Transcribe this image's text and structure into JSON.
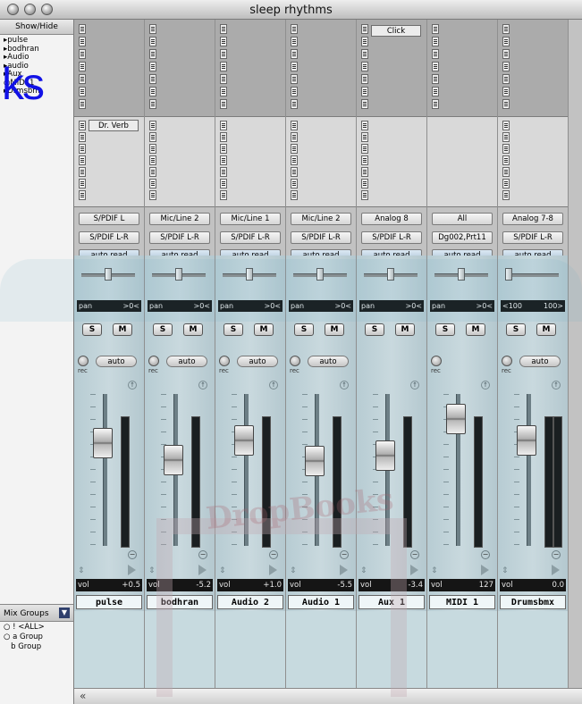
{
  "window": {
    "title": "sleep rhythms"
  },
  "left_panel": {
    "show_hide": "Show/Hide",
    "tree_items": [
      "pulse",
      "bodhran",
      "Audio",
      "audio",
      "Aux",
      "MIDI 1",
      "Drmsbm"
    ],
    "overlay_text": "ks",
    "mix_groups_label": "Mix Groups",
    "groups": [
      {
        "key": "!",
        "name": "<ALL>"
      },
      {
        "key": "a",
        "name": "Group"
      },
      {
        "key": "b",
        "name": "Group"
      }
    ]
  },
  "watermark": {
    "text": "DropBooks"
  },
  "strips": [
    {
      "name": "pulse",
      "insert_top": "",
      "insert_bottom": "Dr. Verb",
      "input": "S/PDIF L",
      "output": "S/PDIF L-R",
      "automation": "auto read",
      "pan_label": "pan",
      "pan_value": ">0<",
      "solo": "S",
      "mute": "M",
      "rec": "rec",
      "auto": "auto",
      "vol_label": "vol",
      "vol_value": "+0.5",
      "fader_level": 0.72,
      "pan_position": 0.5,
      "has_inserts": true
    },
    {
      "name": "bodhran",
      "insert_top": "",
      "insert_bottom": "",
      "input": "Mic/Line 2",
      "output": "S/PDIF L-R",
      "automation": "auto read",
      "pan_label": "pan",
      "pan_value": ">0<",
      "solo": "S",
      "mute": "M",
      "rec": "rec",
      "auto": "auto",
      "vol_label": "vol",
      "vol_value": "-5.2",
      "fader_level": 0.58,
      "pan_position": 0.5,
      "has_inserts": true
    },
    {
      "name": "Audio 2",
      "insert_top": "",
      "insert_bottom": "",
      "input": "Mic/Line 1",
      "output": "S/PDIF L-R",
      "automation": "auto read",
      "pan_label": "pan",
      "pan_value": ">0<",
      "solo": "S",
      "mute": "M",
      "rec": "rec",
      "auto": "auto",
      "vol_label": "vol",
      "vol_value": "+1.0",
      "fader_level": 0.74,
      "pan_position": 0.5,
      "has_inserts": true
    },
    {
      "name": "Audio 1",
      "insert_top": "",
      "insert_bottom": "",
      "input": "Mic/Line 2",
      "output": "S/PDIF L-R",
      "automation": "auto read",
      "pan_label": "pan",
      "pan_value": ">0<",
      "solo": "S",
      "mute": "M",
      "rec": "rec",
      "auto": "auto",
      "vol_label": "vol",
      "vol_value": "-5.5",
      "fader_level": 0.57,
      "pan_position": 0.5,
      "has_inserts": true
    },
    {
      "name": "Aux 1",
      "insert_top": "Click",
      "insert_bottom": "",
      "input": "Analog 8",
      "output": "S/PDIF L-R",
      "automation": "auto read",
      "pan_label": "pan",
      "pan_value": ">0<",
      "solo": "S",
      "mute": "M",
      "rec": "",
      "auto": "",
      "vol_label": "vol",
      "vol_value": "-3.4",
      "fader_level": 0.62,
      "pan_position": 0.5,
      "has_inserts": true
    },
    {
      "name": "MIDI 1",
      "insert_top": "",
      "insert_bottom": "",
      "input": "All",
      "output": "Dg002,Prt11",
      "automation": "auto read",
      "pan_label": "pan",
      "pan_value": ">0<",
      "solo": "S",
      "mute": "M",
      "rec": "rec",
      "auto": "",
      "vol_label": "vol",
      "vol_value": "127",
      "fader_level": 0.92,
      "pan_position": 0.5,
      "has_inserts": false
    },
    {
      "name": "Drumsbmx",
      "insert_top": "",
      "insert_bottom": "",
      "input": "Analog 7-8",
      "output": "S/PDIF L-R",
      "automation": "auto read",
      "pan_label": "<100",
      "pan_value": "100>",
      "solo": "S",
      "mute": "M",
      "rec": "rec",
      "auto": "auto",
      "vol_label": "vol",
      "vol_value": "0.0",
      "fader_level": 0.74,
      "pan_position": 0.0,
      "has_inserts": true
    }
  ]
}
